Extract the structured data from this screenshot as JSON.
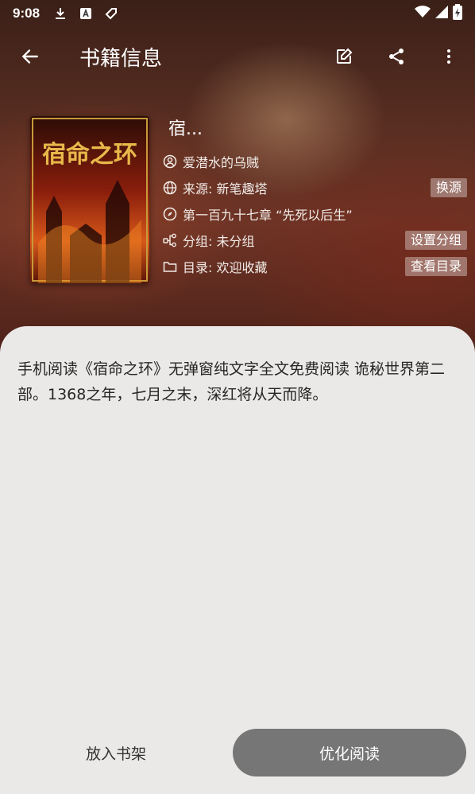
{
  "status_bar": {
    "time": "9:08",
    "icons": [
      "download-icon",
      "font-icon",
      "tag-icon"
    ],
    "right_icons": [
      "wifi-icon",
      "signal-icon",
      "battery-charging-icon"
    ]
  },
  "app_bar": {
    "title": "书籍信息",
    "back_icon": "arrow-back-icon",
    "actions": [
      "edit-icon",
      "share-icon",
      "more-vert-icon"
    ]
  },
  "book": {
    "title": "宿...",
    "cover_title": "宿命之环",
    "author": "爱潜水的乌贼",
    "source": "来源: 新笔趣塔",
    "source_button": "换源",
    "latest_chapter": "第一百九十七章 “先死以后生”",
    "group": "分组: 未分组",
    "group_button": "设置分组",
    "toc": "目录: 欢迎收藏",
    "toc_button": "查看目录"
  },
  "intro": "手机阅读《宿命之环》无弹窗纯文字全文免费阅读 诡秘世界第二部。1368之年，七月之末，深红将从天而降。",
  "buttons": {
    "add_to_shelf": "放入书架",
    "read": "优化阅读"
  },
  "colors": {
    "sheet_bg": "#ebe9e7",
    "read_button": "#767676",
    "chip_bg": "rgba(255,255,255,0.35)"
  }
}
